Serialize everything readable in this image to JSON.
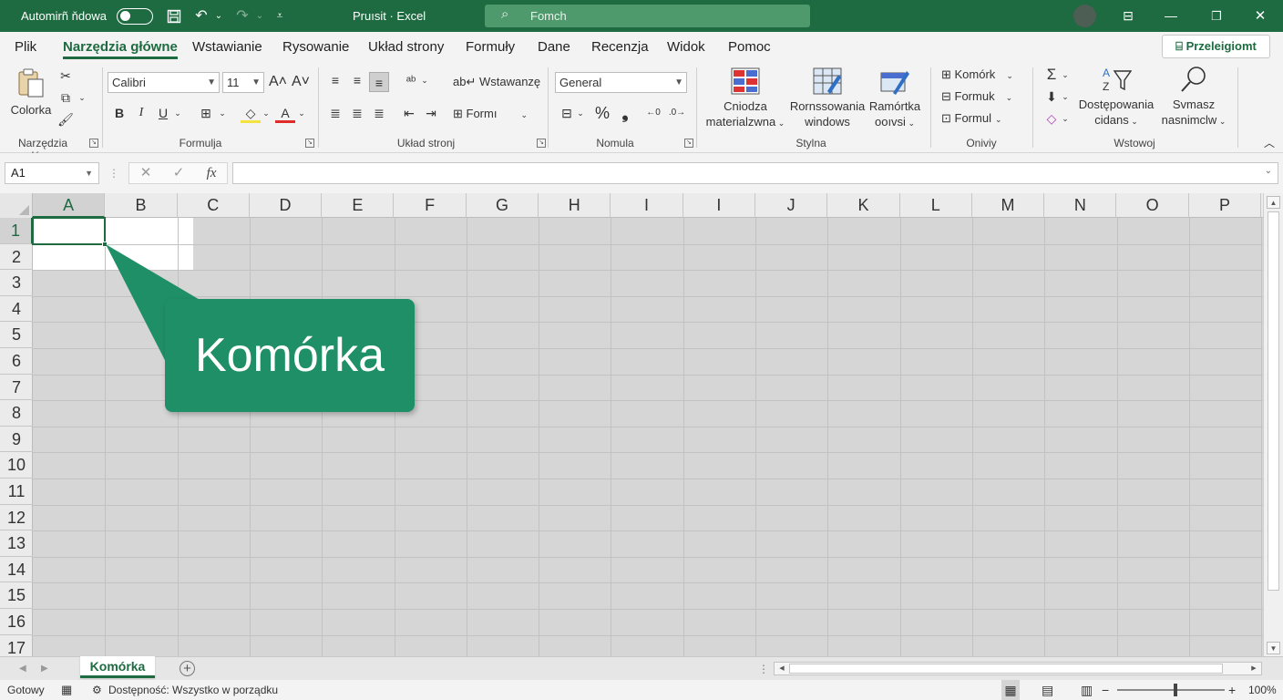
{
  "titlebar": {
    "autosave_label": "Automirñ ňdowa",
    "title": "Pruısit · Excel",
    "search_placeholder": "Fomch",
    "minimize_glyph": "—",
    "restore_glyph": "❐",
    "close_glyph": "✕"
  },
  "menu": {
    "tabs": [
      {
        "label": "Plik"
      },
      {
        "label": "Narzędzia główne"
      },
      {
        "label": "Wstawianie"
      },
      {
        "label": "Rysowanie"
      },
      {
        "label": "Układ strony"
      },
      {
        "label": "Formuły"
      },
      {
        "label": "Dane"
      },
      {
        "label": "Recenzja"
      },
      {
        "label": "Widok"
      },
      {
        "label": "Pomoc"
      }
    ],
    "share_label": "Przeleigiomt"
  },
  "ribbon": {
    "clipboard": {
      "paste_label": "Colorka",
      "group_label": "Narzędzia główne"
    },
    "font": {
      "name": "Calibri",
      "size": "11",
      "bold": "B",
      "italic": "I",
      "underline": "U",
      "grow": "A˄",
      "shrink": "A˅",
      "group_label": "Formulja"
    },
    "alignment": {
      "wrap_label": "Wstawanzę",
      "merge_label": "Formı",
      "group_label": "Układ stronj"
    },
    "number": {
      "format": "General",
      "percent": "%",
      "comma": "❟",
      "group_label": "Nomula"
    },
    "styles": {
      "conditional_label_1": "Cniodza",
      "conditional_label_2": "materialzwna",
      "format_table_label_1": "Rornssowania",
      "format_table_label_2": "windows",
      "cell_styles_label_1": "Ramórtka",
      "cell_styles_label_2": "ooıvsi",
      "group_label": "Stylna"
    },
    "cells": {
      "insert_label": "Komórk",
      "delete_label": "Formuk",
      "format_label": "Formul",
      "group_label": "Oniviy"
    },
    "editing": {
      "sort_label_1": "Dostępowania",
      "sort_label_2": "cidans",
      "find_label_1": "Svmasz",
      "find_label_2": "nasnimclw",
      "group_label": "Wstowoj"
    }
  },
  "formula_bar": {
    "name_box": "A1",
    "fx_label": "fx",
    "cancel_glyph": "✕",
    "enter_glyph": "✓",
    "value": ""
  },
  "grid": {
    "columns": [
      "A",
      "B",
      "C",
      "D",
      "E",
      "F",
      "G",
      "H",
      "I",
      "I",
      "J",
      "K",
      "L",
      "M",
      "N",
      "O",
      "P"
    ],
    "rows": [
      "1",
      "2",
      "3",
      "4",
      "5",
      "6",
      "7",
      "8",
      "9",
      "10",
      "11",
      "12",
      "13",
      "14",
      "15",
      "16",
      "17"
    ],
    "selected_cell": "A1",
    "callout_text": "Komórka",
    "callout_color": "#1f8f68"
  },
  "sheets": {
    "active_tab": "Komórka",
    "add_glyph": "+"
  },
  "status": {
    "ready": "Gotowy",
    "accessibility": "Dostępność: Wszystko w porządku",
    "zoom": "100%",
    "zoom_minus": "−",
    "zoom_plus": "+"
  },
  "colors": {
    "accent": "#1e6b41",
    "titlebar": "#1e6b41",
    "search": "#4f9a6c"
  }
}
